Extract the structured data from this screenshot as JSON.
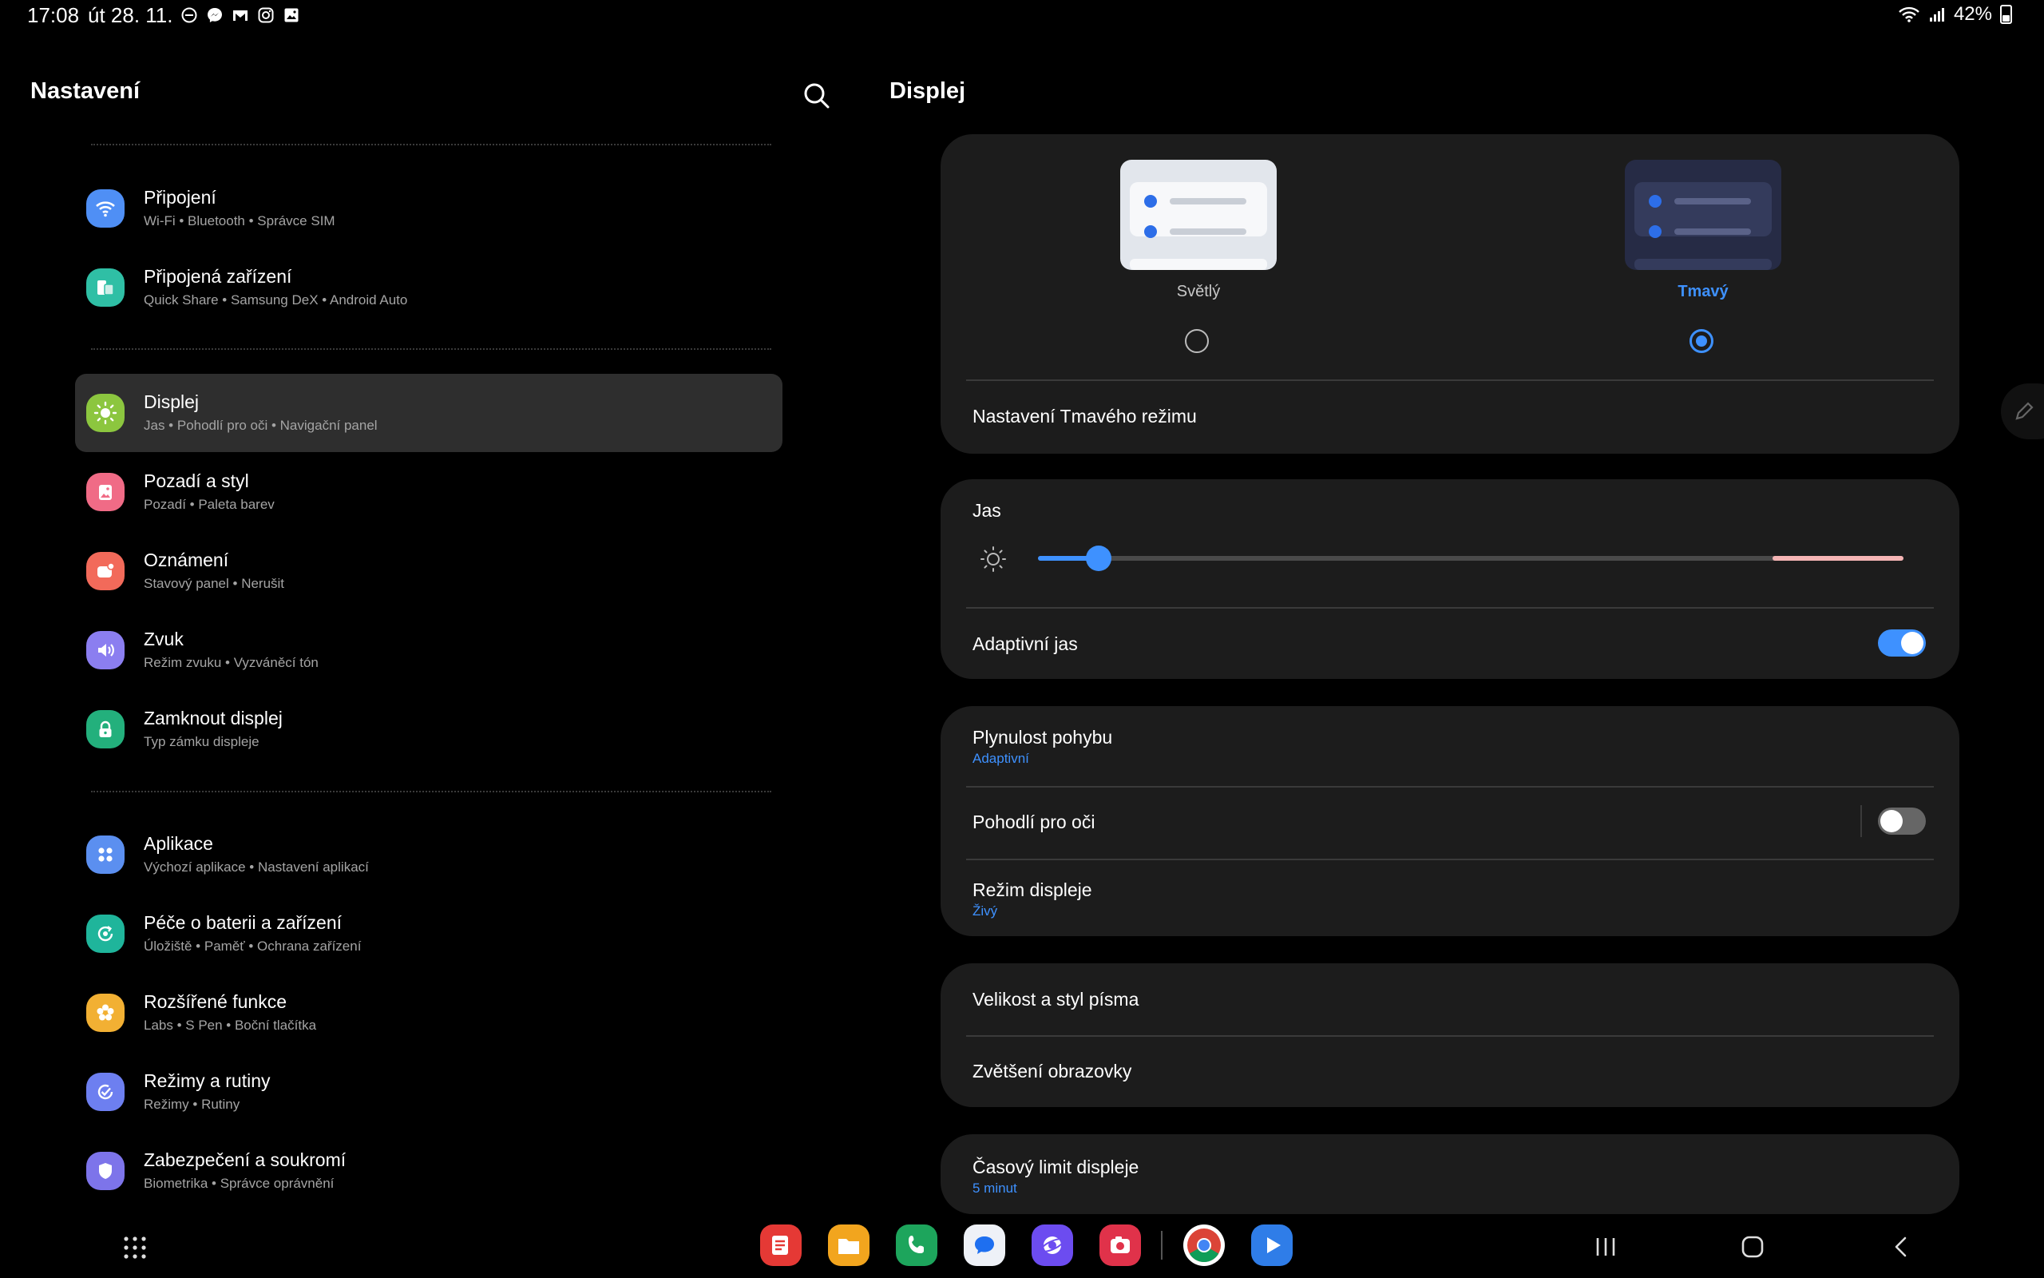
{
  "status": {
    "time": "17:08",
    "date": "út 28. 11.",
    "battery": "42%"
  },
  "left": {
    "title": "Nastavení",
    "items": [
      {
        "label": "Připojení",
        "sub": "Wi-Fi  •  Bluetooth  •  Správce SIM"
      },
      {
        "label": "Připojená zařízení",
        "sub": "Quick Share  •  Samsung DeX  •  Android Auto"
      },
      {
        "label": "Displej",
        "sub": "Jas  •  Pohodlí pro oči  •  Navigační panel"
      },
      {
        "label": "Pozadí a styl",
        "sub": "Pozadí  •  Paleta barev"
      },
      {
        "label": "Oznámení",
        "sub": "Stavový panel  •  Nerušit"
      },
      {
        "label": "Zvuk",
        "sub": "Režim zvuku  •  Vyzváněcí tón"
      },
      {
        "label": "Zamknout displej",
        "sub": "Typ zámku displeje"
      },
      {
        "label": "Aplikace",
        "sub": "Výchozí aplikace  •  Nastavení aplikací"
      },
      {
        "label": "Péče o baterii a zařízení",
        "sub": "Úložiště  •  Paměť  •  Ochrana zařízení"
      },
      {
        "label": "Rozšířené funkce",
        "sub": "Labs  •  S Pen  •  Boční tlačítka"
      },
      {
        "label": "Režimy a rutiny",
        "sub": "Režimy  •  Rutiny"
      },
      {
        "label": "Zabezpečení a soukromí",
        "sub": "Biometrika  •  Správce oprávnění"
      }
    ]
  },
  "right": {
    "title": "Displej",
    "mode_light": "Světlý",
    "mode_dark": "Tmavý",
    "dark_settings": "Nastavení Tmavého režimu",
    "brightness_label": "Jas",
    "brightness_level": 0.07,
    "adaptive_brightness": "Adaptivní jas",
    "motion_smoothness": "Plynulost pohybu",
    "motion_smoothness_value": "Adaptivní",
    "eye_comfort": "Pohodlí pro oči",
    "screen_mode": "Režim displeje",
    "screen_mode_value": "Živý",
    "font_size": "Velikost a styl písma",
    "screen_zoom": "Zvětšení obrazovky",
    "screen_timeout": "Časový limit displeje",
    "screen_timeout_value": "5 minut"
  },
  "colors": {
    "accent": "#3e91ff",
    "card": "#1c1c1c",
    "selected": "#2e2e2e"
  }
}
